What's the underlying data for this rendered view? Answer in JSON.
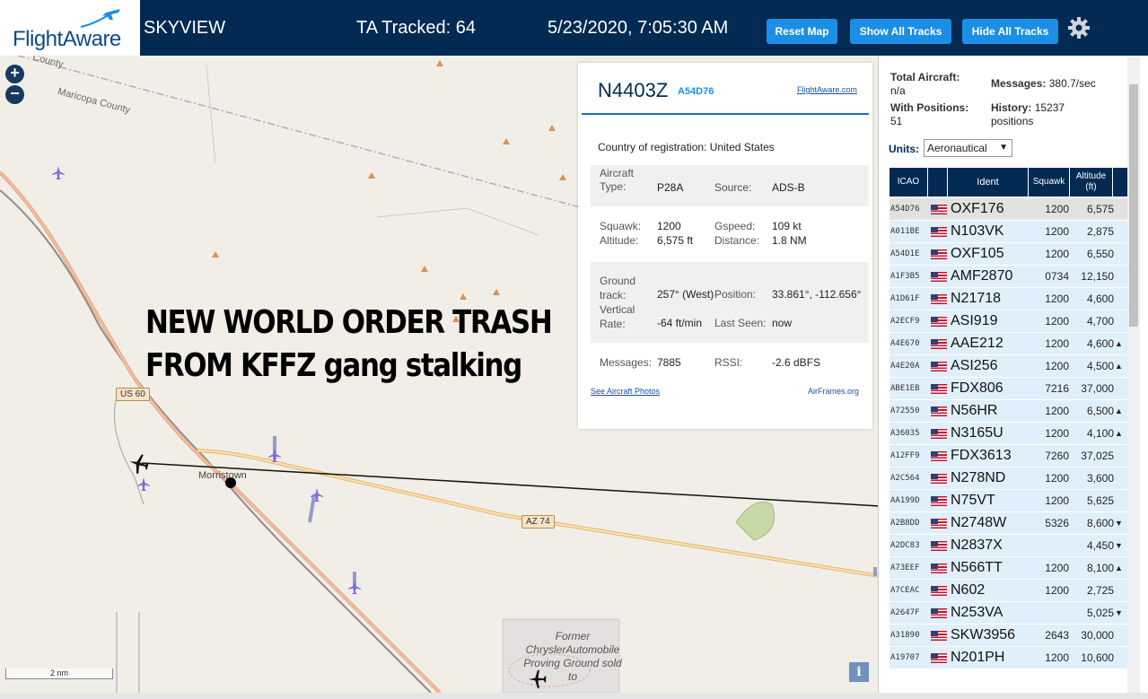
{
  "header": {
    "logo_text": "FlightAware",
    "title": "SKYVIEW",
    "ta_tracked": "TA Tracked: 64",
    "datetime": "5/23/2020, 7:05:30 AM",
    "btn_reset": "Reset Map",
    "btn_show": "Show All Tracks",
    "btn_hide": "Hide All Tracks"
  },
  "map": {
    "county_label": "Maricopa County",
    "county_label_top": "County",
    "us60": "US 60",
    "az74": "AZ 74",
    "town": "Morristown",
    "scale": "2 nm",
    "former_label": "Former ChryslerAutomobile Proving Ground sold to",
    "overlay_line1": "NEW WORLD ORDER TRASH",
    "overlay_line2": "FROM KFFZ gang stalking",
    "info": "i"
  },
  "selected": {
    "registration": "N4403Z",
    "icao": "A54D76",
    "fa_link": "FlightAware.com",
    "country_label": "Country of registration:",
    "country_value": "United States",
    "aircraft_type_label": "Aircraft Type:",
    "aircraft_type": "P28A",
    "source_label": "Source:",
    "source": "ADS-B",
    "squawk_label": "Squawk:",
    "squawk": "1200",
    "gspeed_label": "Gspeed:",
    "gspeed": "109 kt",
    "altitude_label": "Altitude:",
    "altitude": "6,575 ft",
    "distance_label": "Distance:",
    "distance": "1.8 NM",
    "ground_track_label": "Ground track:",
    "ground_track": "257° (West)",
    "position_label": "Position:",
    "position": "33.861°, -112.656°",
    "vertical_rate_label": "Vertical Rate:",
    "vertical_rate": "-64 ft/min",
    "last_seen_label": "Last Seen:",
    "last_seen": "now",
    "messages_label": "Messages:",
    "messages": "7885",
    "rssi_label": "RSSI:",
    "rssi": "-2.6 dBFS",
    "photos_link": "See Aircraft Photos",
    "airframes_link": "AirFrames.org"
  },
  "stats": {
    "total_label": "Total Aircraft:",
    "total": "n/a",
    "messages_label": "Messages:",
    "messages": "380.7/sec",
    "with_pos_label": "With Positions:",
    "with_pos": "51",
    "history_label": "History:",
    "history": "15237 positions",
    "units_label": "Units:",
    "units_value": "Aeronautical"
  },
  "table": {
    "headers": [
      "ICAO",
      "",
      "Ident",
      "Squawk",
      "Altitude (ft)"
    ],
    "rows": [
      {
        "icao": "A54D76",
        "ident": "OXF176",
        "squawk": "1200",
        "alt": "6,575",
        "trend": ""
      },
      {
        "icao": "A011BE",
        "ident": "N103VK",
        "squawk": "1200",
        "alt": "2,875",
        "trend": ""
      },
      {
        "icao": "A54D1E",
        "ident": "OXF105",
        "squawk": "1200",
        "alt": "6,550",
        "trend": ""
      },
      {
        "icao": "A1F3B5",
        "ident": "AMF2870",
        "squawk": "0734",
        "alt": "12,150",
        "trend": ""
      },
      {
        "icao": "A1D61F",
        "ident": "N21718",
        "squawk": "1200",
        "alt": "4,600",
        "trend": ""
      },
      {
        "icao": "A2ECF9",
        "ident": "ASI919",
        "squawk": "1200",
        "alt": "4,700",
        "trend": ""
      },
      {
        "icao": "A4E670",
        "ident": "AAE212",
        "squawk": "1200",
        "alt": "4,600",
        "trend": "▲"
      },
      {
        "icao": "A4E20A",
        "ident": "ASI256",
        "squawk": "1200",
        "alt": "4,500",
        "trend": "▲"
      },
      {
        "icao": "ABE1EB",
        "ident": "FDX806",
        "squawk": "7216",
        "alt": "37,000",
        "trend": ""
      },
      {
        "icao": "A72550",
        "ident": "N56HR",
        "squawk": "1200",
        "alt": "6,500",
        "trend": "▲"
      },
      {
        "icao": "A36035",
        "ident": "N3165U",
        "squawk": "1200",
        "alt": "4,100",
        "trend": "▲"
      },
      {
        "icao": "A12FF9",
        "ident": "FDX3613",
        "squawk": "7260",
        "alt": "37,025",
        "trend": ""
      },
      {
        "icao": "A2C564",
        "ident": "N278ND",
        "squawk": "1200",
        "alt": "3,600",
        "trend": ""
      },
      {
        "icao": "AA199D",
        "ident": "N75VT",
        "squawk": "1200",
        "alt": "5,625",
        "trend": ""
      },
      {
        "icao": "A2B8DD",
        "ident": "N2748W",
        "squawk": "5326",
        "alt": "8,600",
        "trend": "▼"
      },
      {
        "icao": "A2DC83",
        "ident": "N2837X",
        "squawk": "",
        "alt": "4,450",
        "trend": "▼"
      },
      {
        "icao": "A73EEF",
        "ident": "N566TT",
        "squawk": "1200",
        "alt": "8,100",
        "trend": "▲"
      },
      {
        "icao": "A7CEAC",
        "ident": "N602",
        "squawk": "1200",
        "alt": "2,725",
        "trend": ""
      },
      {
        "icao": "A2647F",
        "ident": "N253VA",
        "squawk": "",
        "alt": "5,025",
        "trend": "▼"
      },
      {
        "icao": "A31890",
        "ident": "SKW3956",
        "squawk": "2643",
        "alt": "30,000",
        "trend": ""
      },
      {
        "icao": "A19707",
        "ident": "N201PH",
        "squawk": "1200",
        "alt": "10,600",
        "trend": ""
      }
    ]
  },
  "colors": {
    "header_bg": "#022a52",
    "button_bg": "#1b8fe6",
    "row_bg": "#e0f0fb",
    "selected_row_bg": "#e1e1e1"
  }
}
